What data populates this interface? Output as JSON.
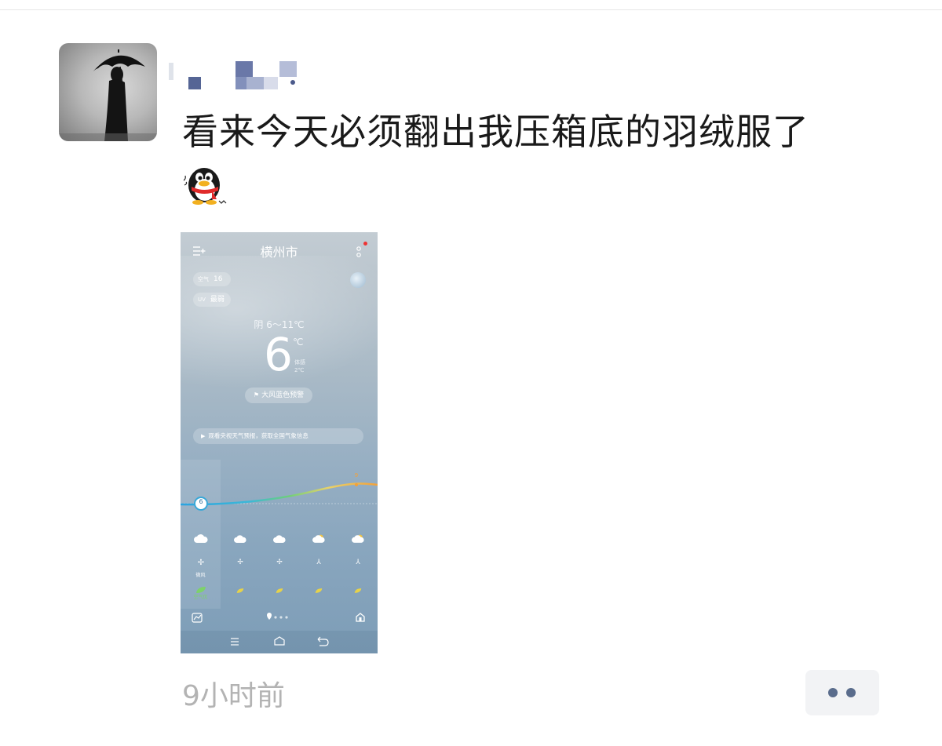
{
  "post": {
    "text": "看来今天必须翻出我压箱底的羽绒服了",
    "time_ago": "9小时前"
  },
  "weather_app": {
    "city": "横州市",
    "aqi_label": "空气",
    "aqi_value": "16",
    "uv_label": "UV",
    "uv_value": "最弱",
    "condition_range": "阴 6～11℃",
    "current_temp": "6",
    "unit": "℃",
    "feels_label": "体感",
    "feels_value": "2℃",
    "alert": "大风蓝色预警",
    "banner": "观看央视天气预报，获取全国气象信息",
    "curve_start_temp": "6",
    "curve_end_temp": "9",
    "wind_label": "微风",
    "air_label": "空气优"
  },
  "colors": {
    "more_button_dots": "#5a6c8c",
    "time_ago": "#b3b3b3",
    "alert_red": "#e33"
  }
}
